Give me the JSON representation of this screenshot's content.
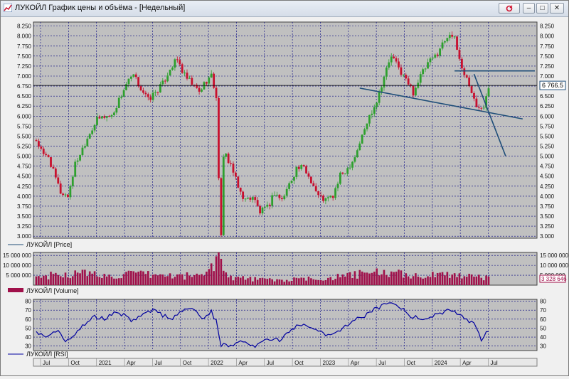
{
  "window": {
    "title": "ЛУКОЙЛ График цены и объёма - [Недельный]",
    "controls": [
      "close-docs",
      "minimize",
      "maximize",
      "close"
    ]
  },
  "colors": {
    "background": "#c0c0c0",
    "grid": "#000080",
    "bull": "#2ea02e",
    "bear": "#c8102e",
    "volume": "#a0104a",
    "rsi": "#0000a0",
    "trendline": "#1f4e79"
  },
  "price_panel": {
    "legend": "ЛУКОЙЛ [Price]",
    "y_ticks": [
      "8.250",
      "8.000",
      "7.750",
      "7.500",
      "7.250",
      "7.000",
      "6.750",
      "6.500",
      "6.250",
      "6.000",
      "5.750",
      "5.500",
      "5.250",
      "5.000",
      "4.750",
      "4.500",
      "4.250",
      "4.000",
      "3.750",
      "3.500",
      "3.250",
      "3.000"
    ],
    "last_price_label": "6 766.5",
    "last_price": 6766.5
  },
  "volume_panel": {
    "legend": "ЛУКОЙЛ [Volume]",
    "y_ticks": [
      "15 000 000",
      "10 000 000",
      "5 000 000"
    ],
    "last_volume_label": "3 328 646"
  },
  "rsi_panel": {
    "legend": "ЛУКОЙЛ [RSI]",
    "y_ticks": [
      "80",
      "70",
      "60",
      "50",
      "40",
      "30"
    ]
  },
  "x_axis": {
    "labels": [
      "Jul",
      "Oct",
      "2021",
      "Apr",
      "Jul",
      "Oct",
      "2022",
      "Apr",
      "Jul",
      "Oct",
      "2023",
      "Apr",
      "Jul",
      "Oct",
      "2024",
      "Apr",
      "Jul"
    ]
  },
  "chart_data": {
    "type": "candlestick",
    "price_range": [
      2950,
      8350
    ],
    "price_path": [
      [
        0,
        5400
      ],
      [
        3,
        5000
      ],
      [
        5,
        5000
      ],
      [
        7,
        4600
      ],
      [
        10,
        4100
      ],
      [
        13,
        4000
      ],
      [
        16,
        4800
      ],
      [
        19,
        5200
      ],
      [
        22,
        5600
      ],
      [
        25,
        5900
      ],
      [
        28,
        6000
      ],
      [
        31,
        6000
      ],
      [
        34,
        6400
      ],
      [
        37,
        6800
      ],
      [
        40,
        7000
      ],
      [
        43,
        6700
      ],
      [
        46,
        6400
      ],
      [
        49,
        6600
      ],
      [
        52,
        6800
      ],
      [
        55,
        7200
      ],
      [
        58,
        7400
      ],
      [
        61,
        7000
      ],
      [
        64,
        6800
      ],
      [
        67,
        6600
      ],
      [
        70,
        6900
      ],
      [
        72,
        7000
      ],
      [
        74,
        6500
      ],
      [
        75,
        4400
      ],
      [
        76,
        3100
      ],
      [
        77,
        4900
      ],
      [
        78,
        5000
      ],
      [
        80,
        4800
      ],
      [
        83,
        4200
      ],
      [
        86,
        3900
      ],
      [
        89,
        4000
      ],
      [
        92,
        3600
      ],
      [
        95,
        3700
      ],
      [
        98,
        4100
      ],
      [
        101,
        3900
      ],
      [
        104,
        4300
      ],
      [
        107,
        4700
      ],
      [
        110,
        4700
      ],
      [
        113,
        4400
      ],
      [
        116,
        4000
      ],
      [
        119,
        3900
      ],
      [
        122,
        4000
      ],
      [
        125,
        4500
      ],
      [
        128,
        4700
      ],
      [
        131,
        5000
      ],
      [
        134,
        5500
      ],
      [
        137,
        6000
      ],
      [
        140,
        6400
      ],
      [
        143,
        7000
      ],
      [
        146,
        7500
      ],
      [
        149,
        7200
      ],
      [
        152,
        6900
      ],
      [
        155,
        6600
      ],
      [
        158,
        7000
      ],
      [
        161,
        7300
      ],
      [
        164,
        7500
      ],
      [
        167,
        7800
      ],
      [
        170,
        8100
      ],
      [
        172,
        7900
      ],
      [
        175,
        7200
      ],
      [
        178,
        6800
      ],
      [
        181,
        6200
      ],
      [
        184,
        6300
      ],
      [
        186,
        6766.5
      ]
    ],
    "weeks": 187,
    "volume_range": [
      0,
      16500000
    ],
    "volume_path": [
      [
        0,
        4000000
      ],
      [
        10,
        5500000
      ],
      [
        20,
        6000000
      ],
      [
        30,
        4500000
      ],
      [
        40,
        5500000
      ],
      [
        50,
        5000000
      ],
      [
        60,
        4500000
      ],
      [
        70,
        5500000
      ],
      [
        75,
        16000000
      ],
      [
        76,
        11000000
      ],
      [
        80,
        4000000
      ],
      [
        90,
        3000000
      ],
      [
        100,
        2500000
      ],
      [
        110,
        3000000
      ],
      [
        120,
        3500000
      ],
      [
        130,
        5000000
      ],
      [
        140,
        6500000
      ],
      [
        150,
        5500000
      ],
      [
        160,
        4500000
      ],
      [
        170,
        5500000
      ],
      [
        180,
        5000000
      ],
      [
        186,
        3328646
      ]
    ],
    "rsi_range": [
      25,
      82
    ],
    "rsi_path": [
      [
        0,
        45
      ],
      [
        4,
        42
      ],
      [
        8,
        48
      ],
      [
        12,
        36
      ],
      [
        16,
        44
      ],
      [
        20,
        55
      ],
      [
        24,
        62
      ],
      [
        28,
        60
      ],
      [
        32,
        68
      ],
      [
        36,
        64
      ],
      [
        40,
        58
      ],
      [
        44,
        67
      ],
      [
        48,
        70
      ],
      [
        52,
        64
      ],
      [
        56,
        60
      ],
      [
        60,
        70
      ],
      [
        64,
        74
      ],
      [
        68,
        60
      ],
      [
        72,
        68
      ],
      [
        74,
        58
      ],
      [
        76,
        30
      ],
      [
        80,
        32
      ],
      [
        86,
        36
      ],
      [
        90,
        30
      ],
      [
        95,
        38
      ],
      [
        100,
        36
      ],
      [
        105,
        50
      ],
      [
        110,
        55
      ],
      [
        115,
        50
      ],
      [
        120,
        42
      ],
      [
        125,
        46
      ],
      [
        130,
        58
      ],
      [
        135,
        64
      ],
      [
        140,
        72
      ],
      [
        145,
        80
      ],
      [
        150,
        72
      ],
      [
        155,
        62
      ],
      [
        160,
        60
      ],
      [
        165,
        65
      ],
      [
        170,
        72
      ],
      [
        175,
        62
      ],
      [
        180,
        55
      ],
      [
        183,
        38
      ],
      [
        186,
        47
      ]
    ],
    "trendlines": [
      {
        "from": [
          133,
          6700
        ],
        "to": [
          200,
          5930
        ]
      },
      {
        "from": [
          172,
          7130
        ],
        "to": [
          205,
          7130
        ]
      },
      {
        "from": [
          180,
          7050
        ],
        "to": [
          193,
          5000
        ]
      }
    ]
  }
}
